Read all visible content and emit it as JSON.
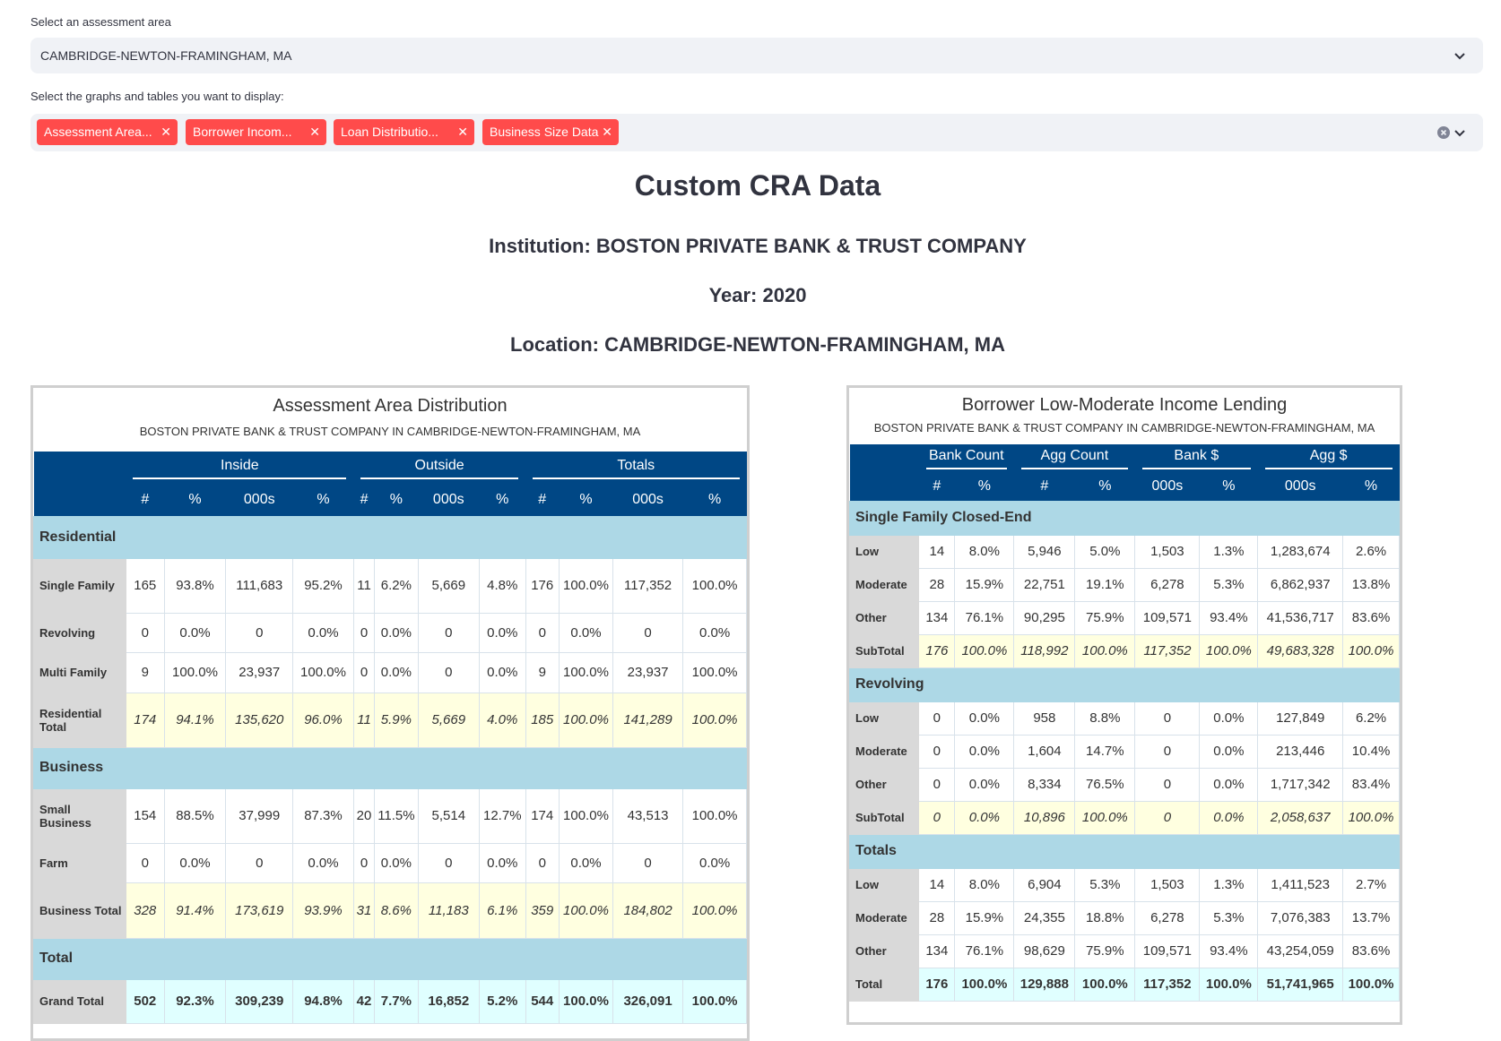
{
  "area_select": {
    "label": "Select an assessment area",
    "value": "CAMBRIDGE-NEWTON-FRAMINGHAM, MA"
  },
  "graphs_select": {
    "label": "Select the graphs and tables you want to display:",
    "tags": [
      "Assessment Area...",
      "Borrower Incom...",
      "Loan Distributio...",
      "Business Size Data"
    ]
  },
  "colors": {
    "tag": "#ff4b4b",
    "header": "#004785",
    "section": "#add8e6",
    "subtotal": "#ffffe0",
    "grand": "#e0ffff"
  },
  "page": {
    "title": "Custom CRA Data",
    "institution": "Institution: BOSTON PRIVATE BANK & TRUST COMPANY",
    "year": "Year: 2020",
    "location": "Location: CAMBRIDGE-NEWTON-FRAMINGHAM, MA"
  },
  "assessment_table": {
    "title": "Assessment Area Distribution",
    "subtitle": "BOSTON PRIVATE BANK & TRUST COMPANY in CAMBRIDGE-NEWTON-FRAMINGHAM, MA",
    "groups": [
      "Inside",
      "Outside",
      "Totals"
    ],
    "columns": [
      "#",
      "%",
      "000s",
      "%",
      "#",
      "%",
      "000s",
      "%",
      "#",
      "%",
      "000s",
      "%"
    ],
    "sections": [
      {
        "name": "Residential",
        "rows": [
          {
            "label": "Single Family",
            "values": [
              "165",
              "93.8%",
              "111,683",
              "95.2%",
              "11",
              "6.2%",
              "5,669",
              "4.8%",
              "176",
              "100.0%",
              "117,352",
              "100.0%"
            ]
          },
          {
            "label": "Revolving",
            "values": [
              "0",
              "0.0%",
              "0",
              "0.0%",
              "0",
              "0.0%",
              "0",
              "0.0%",
              "0",
              "0.0%",
              "0",
              "0.0%"
            ]
          },
          {
            "label": "Multi Family",
            "values": [
              "9",
              "100.0%",
              "23,937",
              "100.0%",
              "0",
              "0.0%",
              "0",
              "0.0%",
              "9",
              "100.0%",
              "23,937",
              "100.0%"
            ]
          },
          {
            "label": "Residential Total",
            "subtotal": true,
            "values": [
              "174",
              "94.1%",
              "135,620",
              "96.0%",
              "11",
              "5.9%",
              "5,669",
              "4.0%",
              "185",
              "100.0%",
              "141,289",
              "100.0%"
            ]
          }
        ]
      },
      {
        "name": "Business",
        "rows": [
          {
            "label": "Small Business",
            "values": [
              "154",
              "88.5%",
              "37,999",
              "87.3%",
              "20",
              "11.5%",
              "5,514",
              "12.7%",
              "174",
              "100.0%",
              "43,513",
              "100.0%"
            ]
          },
          {
            "label": "Farm",
            "values": [
              "0",
              "0.0%",
              "0",
              "0.0%",
              "0",
              "0.0%",
              "0",
              "0.0%",
              "0",
              "0.0%",
              "0",
              "0.0%"
            ]
          },
          {
            "label": "Business Total",
            "subtotal": true,
            "values": [
              "328",
              "91.4%",
              "173,619",
              "93.9%",
              "31",
              "8.6%",
              "11,183",
              "6.1%",
              "359",
              "100.0%",
              "184,802",
              "100.0%"
            ]
          }
        ]
      },
      {
        "name": "Total",
        "rows": [
          {
            "label": "Grand Total",
            "grand": true,
            "values": [
              "502",
              "92.3%",
              "309,239",
              "94.8%",
              "42",
              "7.7%",
              "16,852",
              "5.2%",
              "544",
              "100.0%",
              "326,091",
              "100.0%"
            ]
          }
        ]
      }
    ]
  },
  "borrower_table": {
    "title": "Borrower Low-Moderate Income Lending",
    "subtitle": "BOSTON PRIVATE BANK & TRUST COMPANY in CAMBRIDGE-NEWTON-FRAMINGHAM, MA",
    "groups": [
      "Bank Count",
      "Agg Count",
      "Bank $",
      "Agg $"
    ],
    "columns": [
      "#",
      "%",
      "#",
      "%",
      "000s",
      "%",
      "000s",
      "%"
    ],
    "sections": [
      {
        "name": "Single Family Closed-End",
        "rows": [
          {
            "label": "Low",
            "values": [
              "14",
              "8.0%",
              "5,946",
              "5.0%",
              "1,503",
              "1.3%",
              "1,283,674",
              "2.6%"
            ]
          },
          {
            "label": "Moderate",
            "values": [
              "28",
              "15.9%",
              "22,751",
              "19.1%",
              "6,278",
              "5.3%",
              "6,862,937",
              "13.8%"
            ]
          },
          {
            "label": "Other",
            "values": [
              "134",
              "76.1%",
              "90,295",
              "75.9%",
              "109,571",
              "93.4%",
              "41,536,717",
              "83.6%"
            ]
          },
          {
            "label": "SubTotal",
            "subtotal": true,
            "values": [
              "176",
              "100.0%",
              "118,992",
              "100.0%",
              "117,352",
              "100.0%",
              "49,683,328",
              "100.0%"
            ]
          }
        ]
      },
      {
        "name": "Revolving",
        "rows": [
          {
            "label": "Low",
            "values": [
              "0",
              "0.0%",
              "958",
              "8.8%",
              "0",
              "0.0%",
              "127,849",
              "6.2%"
            ]
          },
          {
            "label": "Moderate",
            "values": [
              "0",
              "0.0%",
              "1,604",
              "14.7%",
              "0",
              "0.0%",
              "213,446",
              "10.4%"
            ]
          },
          {
            "label": "Other",
            "values": [
              "0",
              "0.0%",
              "8,334",
              "76.5%",
              "0",
              "0.0%",
              "1,717,342",
              "83.4%"
            ]
          },
          {
            "label": "SubTotal",
            "subtotal": true,
            "values": [
              "0",
              "0.0%",
              "10,896",
              "100.0%",
              "0",
              "0.0%",
              "2,058,637",
              "100.0%"
            ]
          }
        ]
      },
      {
        "name": "Totals",
        "rows": [
          {
            "label": "Low",
            "values": [
              "14",
              "8.0%",
              "6,904",
              "5.3%",
              "1,503",
              "1.3%",
              "1,411,523",
              "2.7%"
            ]
          },
          {
            "label": "Moderate",
            "values": [
              "28",
              "15.9%",
              "24,355",
              "18.8%",
              "6,278",
              "5.3%",
              "7,076,383",
              "13.7%"
            ]
          },
          {
            "label": "Other",
            "values": [
              "134",
              "76.1%",
              "98,629",
              "75.9%",
              "109,571",
              "93.4%",
              "43,254,059",
              "83.6%"
            ]
          },
          {
            "label": "Total",
            "grand": true,
            "values": [
              "176",
              "100.0%",
              "129,888",
              "100.0%",
              "117,352",
              "100.0%",
              "51,741,965",
              "100.0%"
            ]
          }
        ]
      }
    ]
  }
}
